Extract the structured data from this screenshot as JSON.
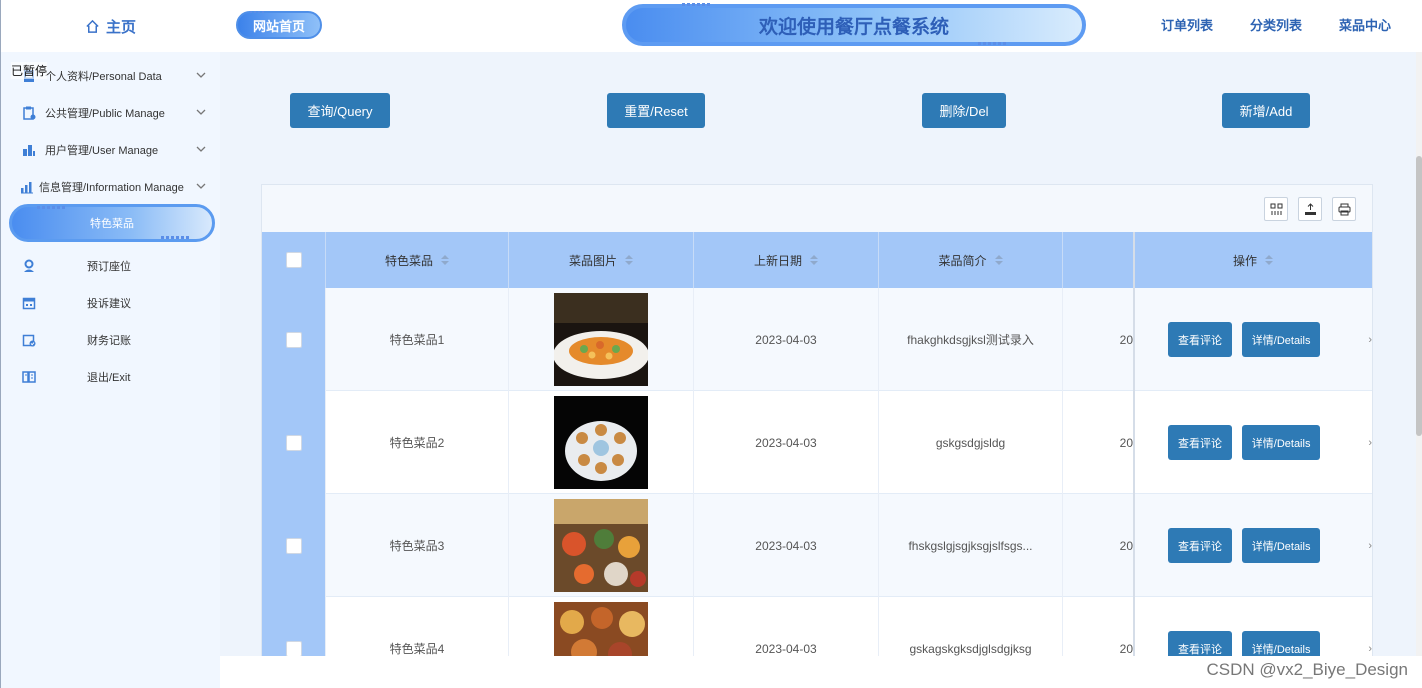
{
  "sidebar": {
    "home_label": "主页",
    "overlay_text": "已暂停",
    "items": [
      {
        "label": "个人资料/Personal Data",
        "icon": "profile-icon"
      },
      {
        "label": "公共管理/Public Manage",
        "icon": "clipboard-icon"
      },
      {
        "label": "用户管理/User Manage",
        "icon": "users-icon"
      },
      {
        "label": "信息管理/Information Manage",
        "icon": "chart-icon"
      }
    ],
    "active_sub": "特色菜品",
    "sub_items": [
      {
        "label": "预订座位",
        "icon": "seat-icon"
      },
      {
        "label": "投诉建议",
        "icon": "calendar-icon"
      },
      {
        "label": "财务记账",
        "icon": "finance-icon"
      },
      {
        "label": "退出/Exit",
        "icon": "exit-icon"
      }
    ]
  },
  "header": {
    "site_home": "网站首页",
    "title": "欢迎使用餐厅点餐系统",
    "nav": [
      "订单列表",
      "分类列表",
      "菜品中心"
    ]
  },
  "actions": {
    "query": "查询/Query",
    "reset": "重置/Reset",
    "delete": "删除/Del",
    "add": "新增/Add"
  },
  "table": {
    "columns": [
      "特色菜品",
      "菜品图片",
      "上新日期",
      "菜品简介",
      "操作"
    ],
    "rows": [
      {
        "name": "特色菜品1",
        "date": "2023-04-03",
        "intro": "fhakghkdsgjksl测试录入",
        "extra": "20"
      },
      {
        "name": "特色菜品2",
        "date": "2023-04-03",
        "intro": "gskgsdgjsldg",
        "extra": "20"
      },
      {
        "name": "特色菜品3",
        "date": "2023-04-03",
        "intro": "fhskgslgjsgjksgjslfsgs...",
        "extra": "20"
      },
      {
        "name": "特色菜品4",
        "date": "2023-04-03",
        "intro": "gskagskgksdjglsdgjksg",
        "extra": "20"
      }
    ],
    "row_actions": {
      "comment": "查看评论",
      "details": "详情/Details"
    },
    "edge_marks": [
      "›",
      "›",
      "›",
      "›"
    ]
  },
  "watermark": "CSDN @vx2_Biye_Design"
}
